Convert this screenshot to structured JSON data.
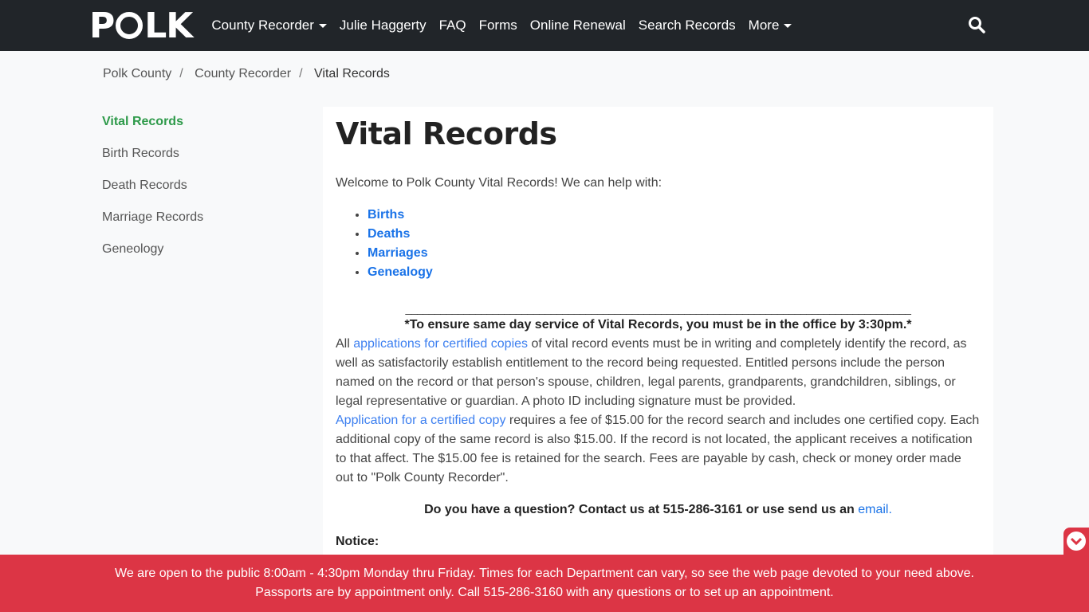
{
  "nav": {
    "logo": "POLK",
    "items": [
      "County Recorder",
      "Julie Haggerty",
      "FAQ",
      "Forms",
      "Online Renewal",
      "Search Records",
      "More"
    ]
  },
  "breadcrumb": [
    "Polk County",
    "County Recorder",
    "Vital Records"
  ],
  "sidebar": [
    "Vital Records",
    "Birth Records",
    "Death Records",
    "Marriage Records",
    "Geneology"
  ],
  "main": {
    "title": "Vital Records",
    "intro": "Welcome to Polk County Vital Records! We can help with:",
    "list": [
      "Births",
      "Deaths",
      "Marriages",
      "Genealogy"
    ],
    "divider": "_______________________________________________________________________________________",
    "notice_bold": "*To ensure same day service of Vital Records, you must be in the office by 3:30pm.*",
    "p1_pre": "All ",
    "p1_link": "applications for certified copies",
    "p1_post": " of vital record events must be in writing and completely identify the record, as well as satisfactorily establish entitlement to the record being requested. Entitled persons include the person named on the record or that person's spouse, children, legal parents, grandparents, grandchildren, siblings, or legal representative or guardian. A photo ID including signature must be provided.",
    "p2_link": "Application for a certified copy",
    "p2_post": " requires a fee of $15.00 for the record search and includes one certified copy. Each additional copy of the same record is also $15.00. If the record is not located, the applicant receives a notification to that affect. The $15.00 fee is retained for the search. Fees are payable by cash, check or money order made out to \"Polk County Recorder\".",
    "question": "Do you have a question?  Contact us at 515-286-3161 or use send us an ",
    "email": "email.",
    "notice": "Notice:"
  },
  "banner": "We are open to the public 8:00am - 4:30pm Monday thru Friday. Times for each Department can vary, so see the web page devoted to your need above. Passports are by appointment only. Call 515-286-3160 with any questions or to set up an appointment.",
  "colors": {
    "nav": "#212529",
    "banner": "#dc3545",
    "active": "#2e9a4a",
    "link": "#1a73e8"
  }
}
